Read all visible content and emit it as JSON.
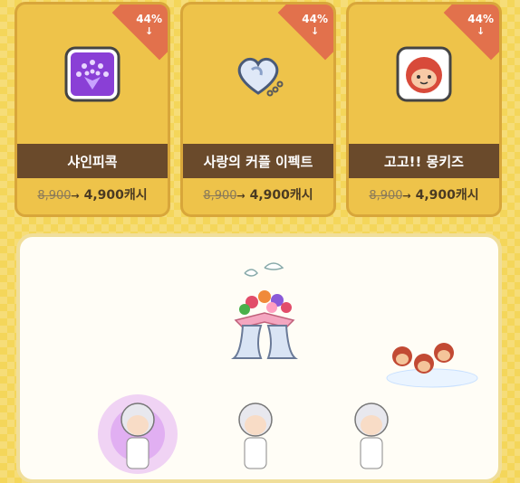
{
  "products": [
    {
      "discount": "44%",
      "name": "샤인피콕",
      "old_price": "8,900",
      "new_price": "4,900캐시",
      "icon": "peacock-icon"
    },
    {
      "discount": "44%",
      "name": "사랑의 커플 이펙트",
      "old_price": "8,900",
      "new_price": "4,900캐시",
      "icon": "heart-locket-icon"
    },
    {
      "discount": "44%",
      "name": "고고!! 몽키즈",
      "old_price": "8,900",
      "new_price": "4,900캐시",
      "icon": "monkey-icon"
    }
  ],
  "colors": {
    "card_bg": "#eec34a",
    "ribbon": "#e2714c",
    "name_bar": "#6a4a2b",
    "page_bg": "#f4d65a"
  }
}
